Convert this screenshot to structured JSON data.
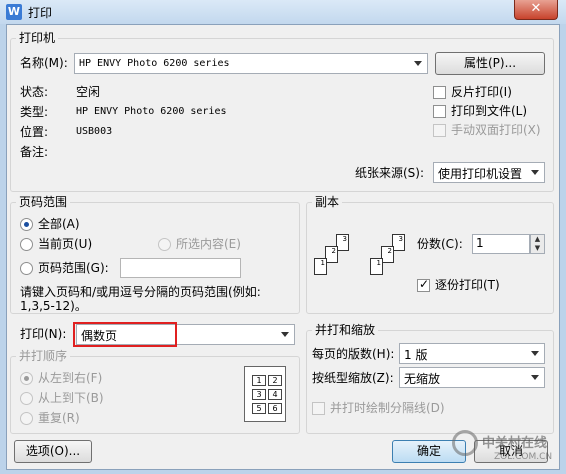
{
  "window": {
    "title": "打印",
    "app_icon": "W",
    "close_glyph": "✕"
  },
  "printer": {
    "group_title": "打印机",
    "name_label": "名称(M):",
    "name_value": "HP ENVY Photo 6200 series",
    "properties_button": "属性(P)...",
    "status_label": "状态:",
    "status_value": "空闲",
    "type_label": "类型:",
    "type_value": "HP ENVY Photo 6200 series",
    "location_label": "位置:",
    "location_value": "USB003",
    "comment_label": "备注:",
    "reverse_print": "反片打印(I)",
    "print_to_file": "打印到文件(L)",
    "manual_duplex": "手动双面打印(X)",
    "paper_source_label": "纸张来源(S):",
    "paper_source_value": "使用打印机设置"
  },
  "page_range": {
    "group_title": "页码范围",
    "all": "全部(A)",
    "current": "当前页(U)",
    "selection": "所选内容(E)",
    "range": "页码范围(G):",
    "range_value": "",
    "hint_line1": "请键入页码和/或用逗号分隔的页码范围(例如:",
    "hint_line2": "1,3,5-12)。",
    "print_label": "打印(N):",
    "print_value": "偶数页",
    "highlight_color": "#e02020"
  },
  "collate_order": {
    "group_title": "并打顺序",
    "left_to_right": "从左到右(F)",
    "top_to_bottom": "从上到下(B)",
    "repeat": "重复(R)",
    "grid": [
      "1",
      "2",
      "3",
      "4",
      "5",
      "6"
    ]
  },
  "copies": {
    "group_title": "副本",
    "count_label": "份数(C):",
    "count_value": "1",
    "collate": "逐份打印(T)",
    "stack_pages": [
      "1",
      "2",
      "3"
    ]
  },
  "zoom": {
    "group_title": "并打和缩放",
    "pages_per_sheet_label": "每页的版数(H):",
    "pages_per_sheet_value": "1 版",
    "scale_label": "按纸型缩放(Z):",
    "scale_value": "无缩放",
    "draw_borders": "并打时绘制分隔线(D)"
  },
  "footer": {
    "options_button": "选项(O)...",
    "ok_button": "确定",
    "cancel_button": "取消"
  },
  "watermark": {
    "line1": "中关村在线",
    "line2": "ZOL.COM.CN"
  }
}
